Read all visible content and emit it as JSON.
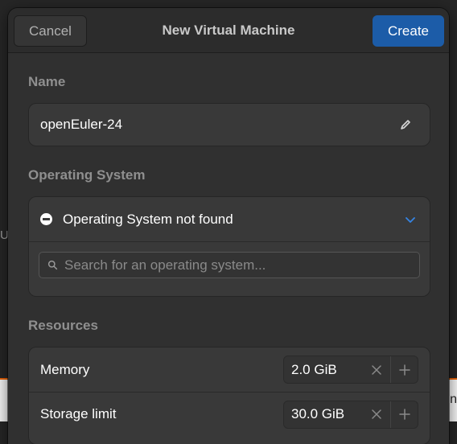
{
  "background": {
    "left_fragment": "Us",
    "right_fragment": "n",
    "accent_color": "#e66100"
  },
  "header": {
    "cancel_label": "Cancel",
    "title": "New Virtual Machine",
    "create_label": "Create",
    "create_color": "#1c5ca8"
  },
  "name_section": {
    "heading": "Name",
    "value": "openEuler-24",
    "icon": "edit-pencil-icon"
  },
  "os_section": {
    "heading": "Operating System",
    "status_text": "Operating System not found",
    "status_icon": "minus-circle-icon",
    "expand_icon": "chevron-down-icon",
    "search_placeholder": "Search for an operating system..."
  },
  "resources_section": {
    "heading": "Resources",
    "rows": [
      {
        "label": "Memory",
        "value": "2.0 GiB"
      },
      {
        "label": "Storage limit",
        "value": "30.0 GiB"
      }
    ]
  }
}
